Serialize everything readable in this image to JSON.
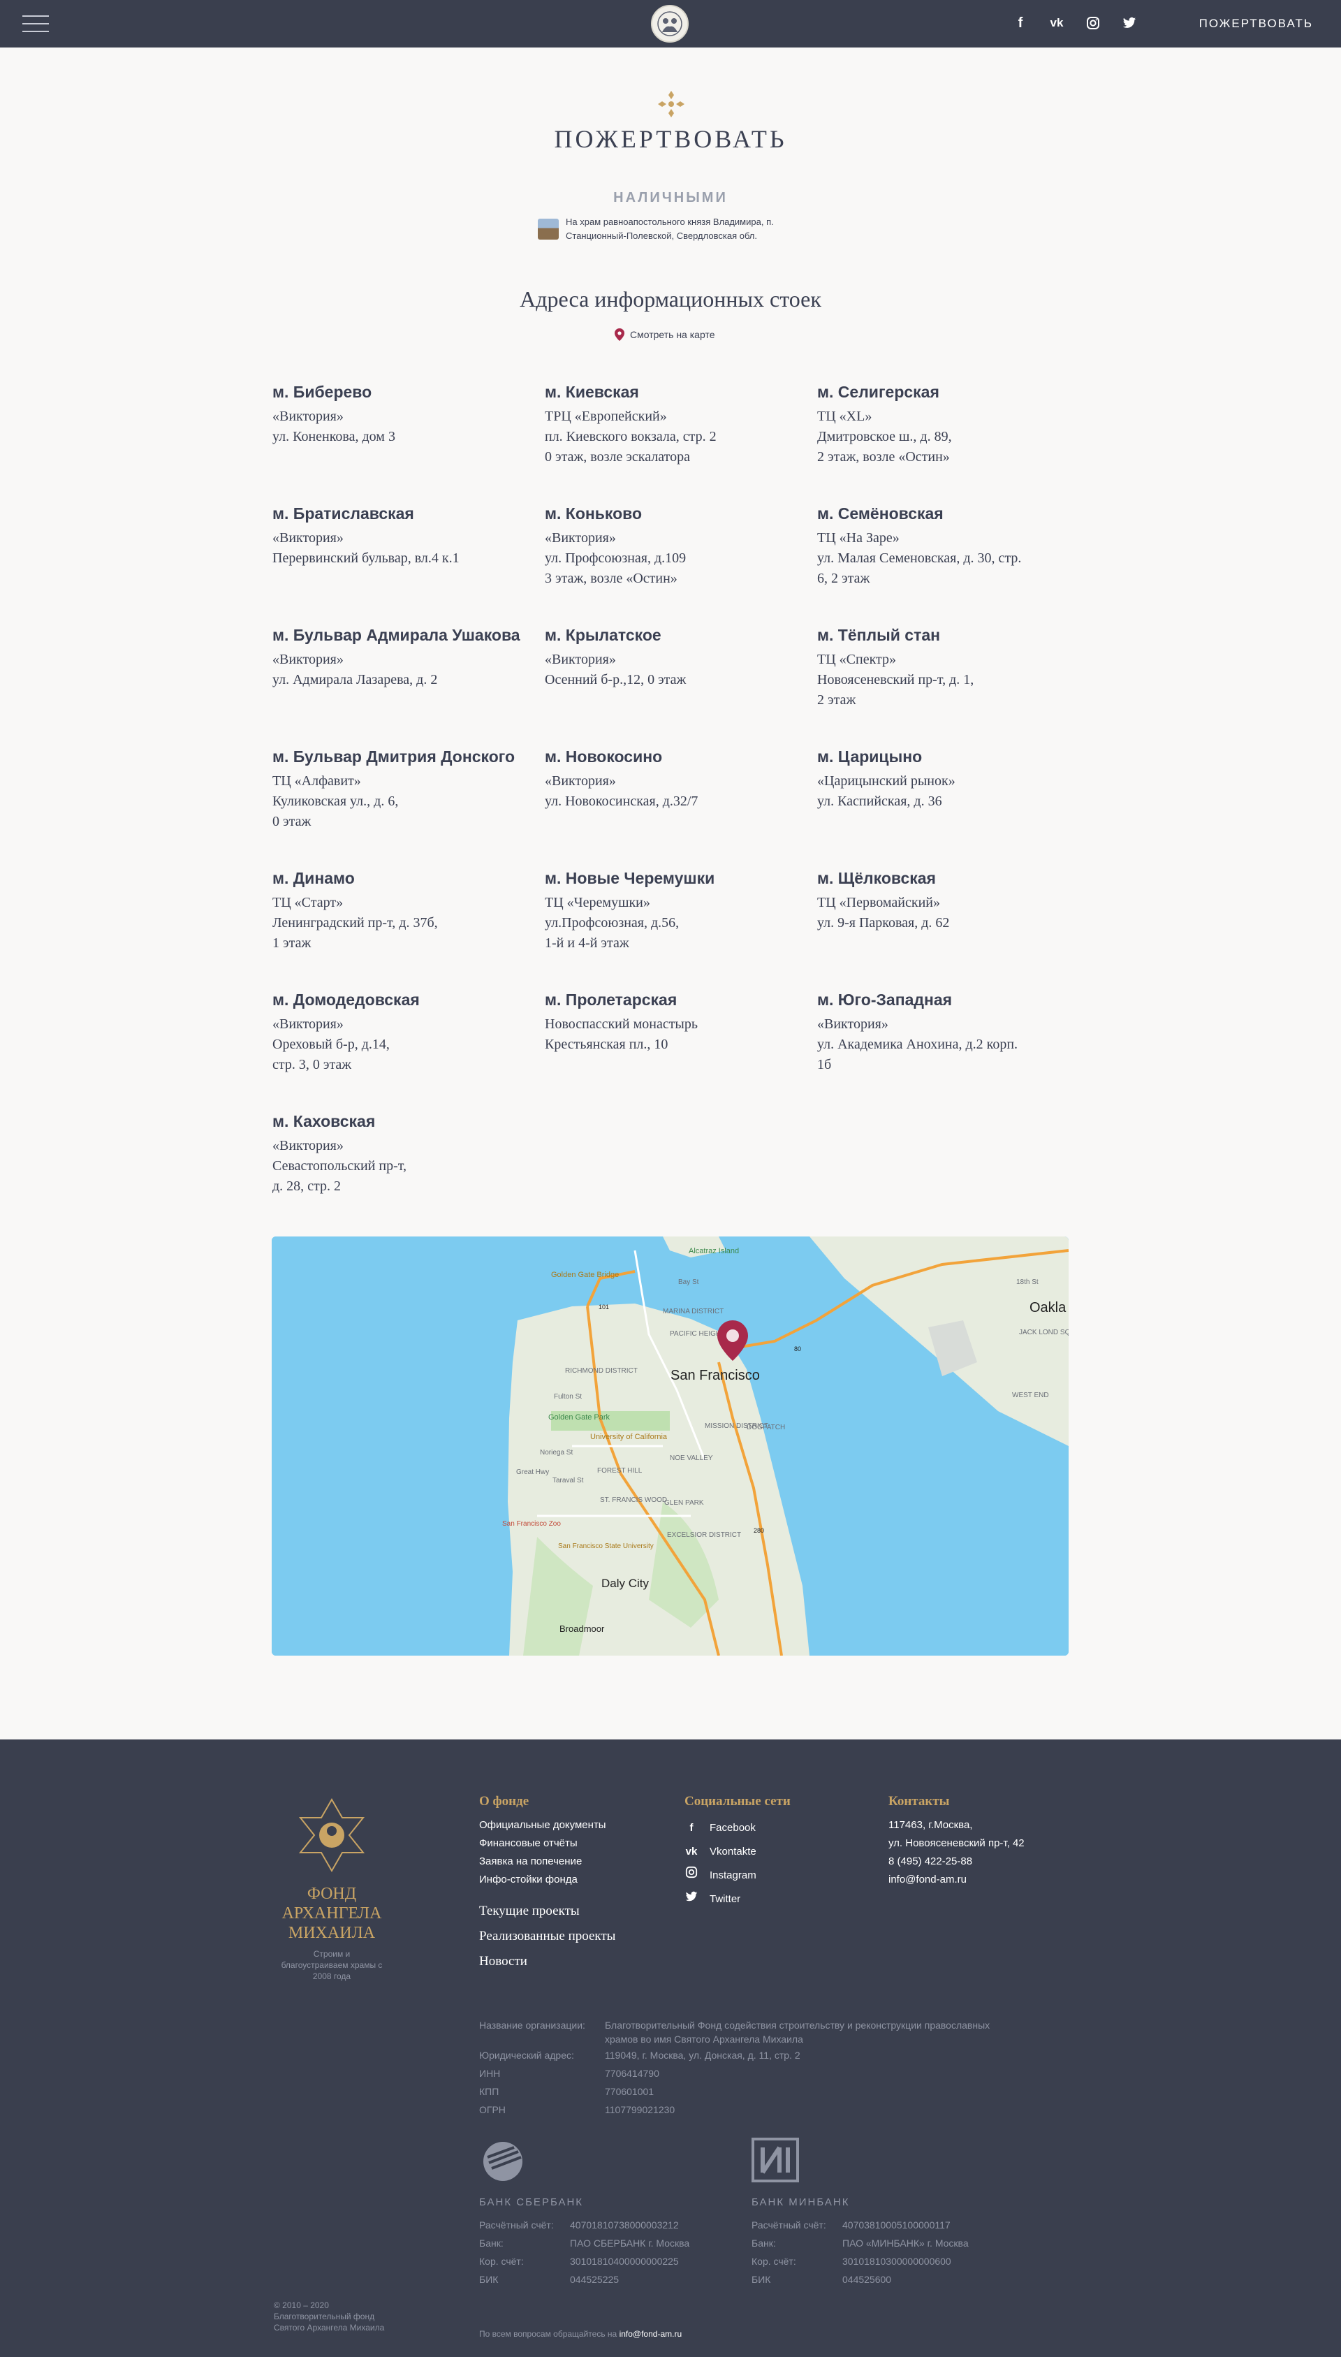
{
  "header": {
    "donate_label": "ПОЖЕРТВОВАТЬ",
    "social": [
      "facebook-icon",
      "vk-icon",
      "instagram-icon",
      "twitter-icon"
    ]
  },
  "page": {
    "title": "ПОЖЕРТВОВАТЬ",
    "cash_label": "НАЛИЧНЫМИ",
    "church_text": "На храм равноапостольного князя Владимира, п. Станционный-Полевской, Свердловская обл.",
    "stands_title": "Адреса информационных стоек",
    "map_link": "Смотреть на карте"
  },
  "stops": [
    {
      "name": "м. Биберево",
      "lines": [
        "«Виктория»",
        "ул. Коненкова, дом 3"
      ]
    },
    {
      "name": "м. Киевская",
      "lines": [
        "ТРЦ «Европейский»",
        "пл. Киевского вокзала, стр. 2",
        "0 этаж, возле эскалатора"
      ]
    },
    {
      "name": "м. Селигерская",
      "lines": [
        "ТЦ «XL»",
        "Дмитровское ш., д. 89,",
        "2 этаж, возле «Остин»"
      ]
    },
    {
      "name": "м. Братиславская",
      "lines": [
        "«Виктория»",
        "Перервинский бульвар, вл.4 к.1"
      ]
    },
    {
      "name": "м. Коньково",
      "lines": [
        "«Виктория»",
        "ул. Профсоюзная, д.109",
        "3 этаж, возле «Остин»"
      ]
    },
    {
      "name": "м. Семёновская",
      "lines": [
        "ТЦ «На Заре»",
        "ул. Малая Семеновская, д. 30, стр.",
        "6,  2 этаж"
      ]
    },
    {
      "name": "м. Бульвар Адмирала Ушакова",
      "lines": [
        "«Виктория»",
        "ул. Адмирала Лазарева, д. 2"
      ]
    },
    {
      "name": "м. Крылатское",
      "lines": [
        "«Виктория»",
        "Осенний б-р.,12, 0 этаж"
      ]
    },
    {
      "name": "м. Тёплый стан",
      "lines": [
        "ТЦ «Спектр»",
        "Новоясеневский пр-т, д. 1,",
        "2 этаж"
      ]
    },
    {
      "name": "м. Бульвар Дмитрия Донского",
      "lines": [
        "ТЦ «Алфавит»",
        "Куликовская ул., д. 6,",
        "0 этаж"
      ]
    },
    {
      "name": "м. Новокосино",
      "lines": [
        "«Виктория»",
        "ул. Новокосинская, д.32/7"
      ]
    },
    {
      "name": "м. Царицыно",
      "lines": [
        "«Царицынский рынок»",
        "ул. Каспийская, д. 36"
      ]
    },
    {
      "name": "м. Динамо",
      "lines": [
        "ТЦ «Старт»",
        "Ленинградский пр-т, д. 37б,",
        "1 этаж"
      ]
    },
    {
      "name": "м. Новые Черемушки",
      "lines": [
        "ТЦ «Черемушки»",
        "ул.Профсоюзная, д.56,",
        "1-й и 4-й этаж"
      ]
    },
    {
      "name": "м. Щёлковская",
      "lines": [
        "ТЦ «Первомайский»",
        "ул. 9-я Парковая, д. 62"
      ]
    },
    {
      "name": "м. Домодедовская",
      "lines": [
        "«Виктория»",
        "Ореховый б-р, д.14,",
        "стр. 3, 0 этаж"
      ]
    },
    {
      "name": "м. Пролетарская",
      "lines": [
        "Новоспасский монастырь",
        "Крестьянская пл., 10"
      ]
    },
    {
      "name": "м. Юго-Западная",
      "lines": [
        "«Виктория»",
        "ул. Академика Анохина, д.2 корп.",
        "1б"
      ]
    },
    {
      "name": "м. Каховская",
      "lines": [
        "«Виктория»",
        "Севастопольский пр-т,",
        "д. 28, стр. 2"
      ]
    }
  ],
  "map": {
    "labels": [
      "Alcatraz Island",
      "Golden Gate Bridge",
      "MARINA DISTRICT",
      "PACIFIC HEIGHTS",
      "RICHMOND DISTRICT",
      "San Francisco",
      "Golden Gate Park",
      "University of California",
      "Noriega St",
      "Taraval St",
      "NOE VALLEY",
      "FOREST HILL",
      "MISSION DISTRICT",
      "ST. FRANCIS WOOD",
      "GLEN PARK",
      "San Francisco Zoo",
      "San Francisco State University",
      "EXCELSIOR DISTRICT",
      "Daly City",
      "Broadmoor",
      "Oakla",
      "WEST END",
      "JACK LOND SQUARE",
      "Bay St",
      "Fulton St",
      "Great Hwy",
      "DOGPATCH",
      "18th St",
      "101",
      "280",
      "80"
    ]
  },
  "footer": {
    "logo_name": [
      "ФОНД",
      "АРХАНГЕЛА",
      "МИХАИЛА"
    ],
    "logo_sub": "Строим и благоустраиваем храмы с 2008 года",
    "about": {
      "title": "О фонде",
      "links": [
        "Официальные документы",
        "Финансовые отчёты",
        "Заявка на попечение",
        "Инфо-стойки фонда"
      ],
      "big_links": [
        "Текущие проекты",
        "Реализованные проекты",
        "Новости"
      ]
    },
    "social": {
      "title": "Социальные сети",
      "items": [
        {
          "icon": "facebook-icon",
          "label": "Facebook"
        },
        {
          "icon": "vk-icon",
          "label": "Vkontakte"
        },
        {
          "icon": "instagram-icon",
          "label": "Instagram"
        },
        {
          "icon": "twitter-icon",
          "label": "Twitter"
        }
      ]
    },
    "contacts": {
      "title": "Контакты",
      "lines": [
        "117463, г.Москва,",
        "ул. Новоясеневский пр-т, 42",
        "8 (495) 422-25-88",
        "info@fond-am.ru"
      ]
    },
    "requisites": [
      {
        "k": "Название организации:",
        "v": "Благотворительный Фонд содействия строительству и реконструкции православных храмов во имя Святого Архангела Михаила"
      },
      {
        "k": "Юридический адрес:",
        "v": "119049, г. Москва, ул. Донская, д. 11, стр. 2"
      },
      {
        "k": "ИНН",
        "v": "7706414790"
      },
      {
        "k": "КПП",
        "v": "770601001"
      },
      {
        "k": "ОГРН",
        "v": "1107799021230"
      }
    ],
    "banks": [
      {
        "name": "БАНК СБЕРБАНК",
        "rows": [
          {
            "k": "Расчётный счёт:",
            "v": "40701810738000003212"
          },
          {
            "k": "Банк:",
            "v": "ПАО СБЕРБАНК г. Москва"
          },
          {
            "k": "Кор. счёт:",
            "v": "30101810400000000225"
          },
          {
            "k": "БИК",
            "v": "044525225"
          }
        ]
      },
      {
        "name": "БАНК МИНБАНК",
        "rows": [
          {
            "k": "Расчётный счёт:",
            "v": "40703810005100000117"
          },
          {
            "k": "Банк:",
            "v": "ПАО «МИНБАНК» г. Москва"
          },
          {
            "k": "Кор. счёт:",
            "v": "30101810300000000600"
          },
          {
            "k": "БИК",
            "v": "044525600"
          }
        ]
      }
    ],
    "copyright": [
      "© 2010 – 2020",
      "Благотворительный фонд",
      "Святого Архангела Михаила"
    ],
    "contact_note": "По всем вопросам обращайтесь на",
    "contact_email": "info@fond-am.ru"
  },
  "colors": {
    "header_bg": "#3a3f4e",
    "accent_gold": "#c9a464",
    "pin": "#a8294b",
    "water": "#7ccbf0"
  }
}
